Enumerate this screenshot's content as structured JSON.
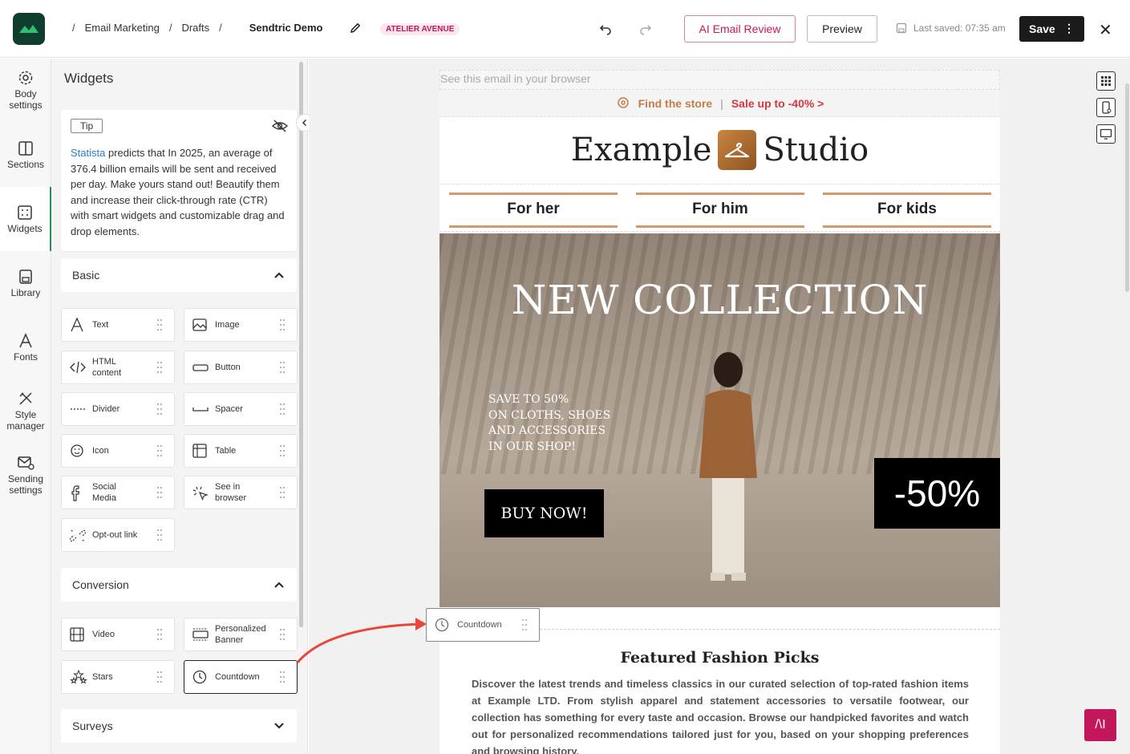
{
  "header": {
    "breadcrumbs": [
      "Email Marketing",
      "Drafts"
    ],
    "current": "Sendtric Demo",
    "badge": "ATELIER AVENUE",
    "ai_review": "AI Email Review",
    "preview": "Preview",
    "last_saved": "Last saved: 07:35 am",
    "save": "Save",
    "save_menu": "⋮",
    "close": "✕"
  },
  "rail": [
    {
      "label": "Body\nsettings",
      "icon": "gear-icon"
    },
    {
      "label": "Sections",
      "icon": "columns-icon"
    },
    {
      "label": "Widgets",
      "icon": "grid-icon"
    },
    {
      "label": "Library",
      "icon": "save-icon"
    },
    {
      "label": "Fonts",
      "icon": "font-icon"
    },
    {
      "label": "Style\nmanager",
      "icon": "style-icon"
    },
    {
      "label": "Sending\nsettings",
      "icon": "mail-settings-icon"
    }
  ],
  "panel": {
    "title": "Widgets",
    "tip_label": "Tip",
    "tip_link": "Statista",
    "tip_text": " predicts that In 2025, an average of 376.4 billion emails will be sent and received per day. Make yours stand out! Beautify them and increase their click-through rate (CTR) with smart widgets and customizable drag and drop elements.",
    "basic_title": "Basic",
    "conversion_title": "Conversion",
    "surveys_title": "Surveys",
    "basic": [
      {
        "label": "Text",
        "icon": "text-icon"
      },
      {
        "label": "Image",
        "icon": "image-icon"
      },
      {
        "label": "HTML\ncontent",
        "icon": "code-icon"
      },
      {
        "label": "Button",
        "icon": "button-icon"
      },
      {
        "label": "Divider",
        "icon": "divider-icon"
      },
      {
        "label": "Spacer",
        "icon": "spacer-icon"
      },
      {
        "label": "Icon",
        "icon": "emoji-icon"
      },
      {
        "label": "Table",
        "icon": "table-icon"
      },
      {
        "label": "Social\nMedia",
        "icon": "social-icon"
      },
      {
        "label": "See in\nbrowser",
        "icon": "cursor-icon"
      },
      {
        "label": "Opt-out link",
        "icon": "unlink-icon"
      }
    ],
    "conversion": [
      {
        "label": "Video",
        "icon": "video-icon"
      },
      {
        "label": "Personalized\nBanner",
        "icon": "banner-icon"
      },
      {
        "label": "Stars",
        "icon": "stars-icon"
      },
      {
        "label": "Countdown",
        "icon": "clock-icon"
      }
    ]
  },
  "email": {
    "browser_link": "See this email in your browser",
    "find_store": "Find the store",
    "separator": "|",
    "sale": "Sale up to -40%  >",
    "brand_left": "Example",
    "brand_right": "Studio",
    "nav": [
      "For her",
      "For him",
      "For kids"
    ],
    "hero_title": "NEW COLLECTION",
    "hero_sub": [
      "SAVE TO 50%",
      "ON CLOTHS, SHOES",
      "AND ACCESSORIES",
      "IN OUR SHOP!"
    ],
    "hero_cta": "BUY NOW!",
    "hero_discount": "-50%",
    "featured_title": "Featured Fashion Picks",
    "featured_text": "Discover the latest trends and timeless classics in our curated selection of top-rated fashion items at Example LTD. From stylish apparel and statement accessories to versatile footwear, our collection has something for every taste and occasion. Browse our handpicked favorites and watch out for personalized recommendations tailored just for you, based on your shopping preferences and browsing history."
  },
  "drag_ghost": {
    "label": "Countdown"
  },
  "ai_fab": "/\\I",
  "colors": {
    "accent": "#c2185b",
    "brand_green": "#0f3d2e",
    "nav_rule": "#d09a6c",
    "sale": "#d9363e"
  }
}
